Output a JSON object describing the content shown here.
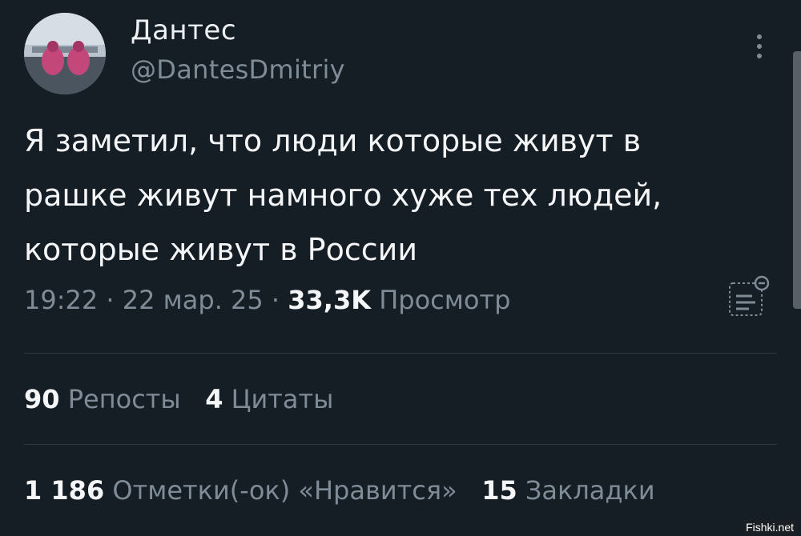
{
  "author": {
    "display_name": "Дантес",
    "handle": "@DantesDmitriy"
  },
  "tweet": {
    "text": "Я заметил, что люди которые живут в\nрашке живут намного хуже  тех людей,\nкоторые живут в России"
  },
  "meta": {
    "time": "19:22",
    "separator": " · ",
    "date": "22 мар. 25",
    "views_count": "33,3K",
    "views_label": "Просмотр"
  },
  "stats": {
    "reposts_count": "90",
    "reposts_label": "Репосты",
    "quotes_count": "4",
    "quotes_label": "Цитаты",
    "likes_count": "1 186",
    "likes_label": "Отметки(-ок) «Нравится»",
    "bookmarks_count": "15",
    "bookmarks_label": "Закладки"
  },
  "watermark": "Fishki.net",
  "icons": [
    "more-vertical-icon",
    "analytics-icon"
  ],
  "colors": {
    "background": "#151d25",
    "text_primary": "#f4f6f8",
    "text_secondary": "#7f8c97",
    "divider": "#2f3942"
  }
}
